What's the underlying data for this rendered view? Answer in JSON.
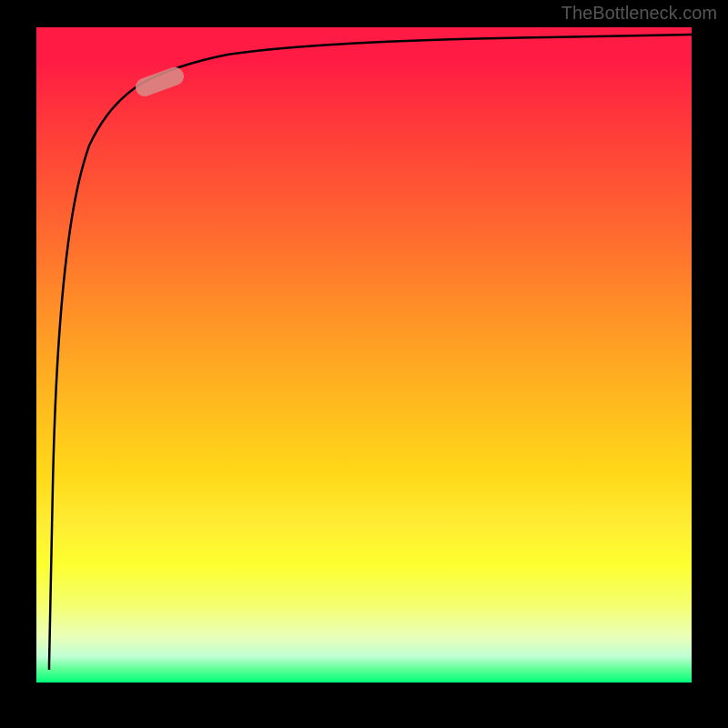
{
  "watermark": "TheBottleneck.com",
  "chart_data": {
    "type": "line",
    "title": "",
    "xlabel": "",
    "ylabel": "",
    "xlim": [
      0,
      100
    ],
    "ylim": [
      0,
      100
    ],
    "series": [
      {
        "name": "curve",
        "x": [
          2,
          2.5,
          3,
          3.5,
          4,
          5,
          6,
          8,
          10,
          13,
          16,
          20,
          25,
          32,
          40,
          50,
          60,
          72,
          85,
          100
        ],
        "y": [
          2,
          30,
          50,
          62,
          70,
          78,
          83,
          88,
          90.5,
          92.2,
          93.3,
          94.2,
          95,
          95.7,
          96.3,
          96.8,
          97.2,
          97.5,
          97.8,
          98
        ]
      }
    ],
    "highlight_segment": {
      "x_range": [
        12,
        18
      ],
      "y_range": [
        91.5,
        93.5
      ]
    },
    "gradient_stops": [
      {
        "pos": 0,
        "color": "#ff1b44"
      },
      {
        "pos": 50,
        "color": "#ff8c28"
      },
      {
        "pos": 80,
        "color": "#ffff2f"
      },
      {
        "pos": 100,
        "color": "#00ff7a"
      }
    ]
  }
}
